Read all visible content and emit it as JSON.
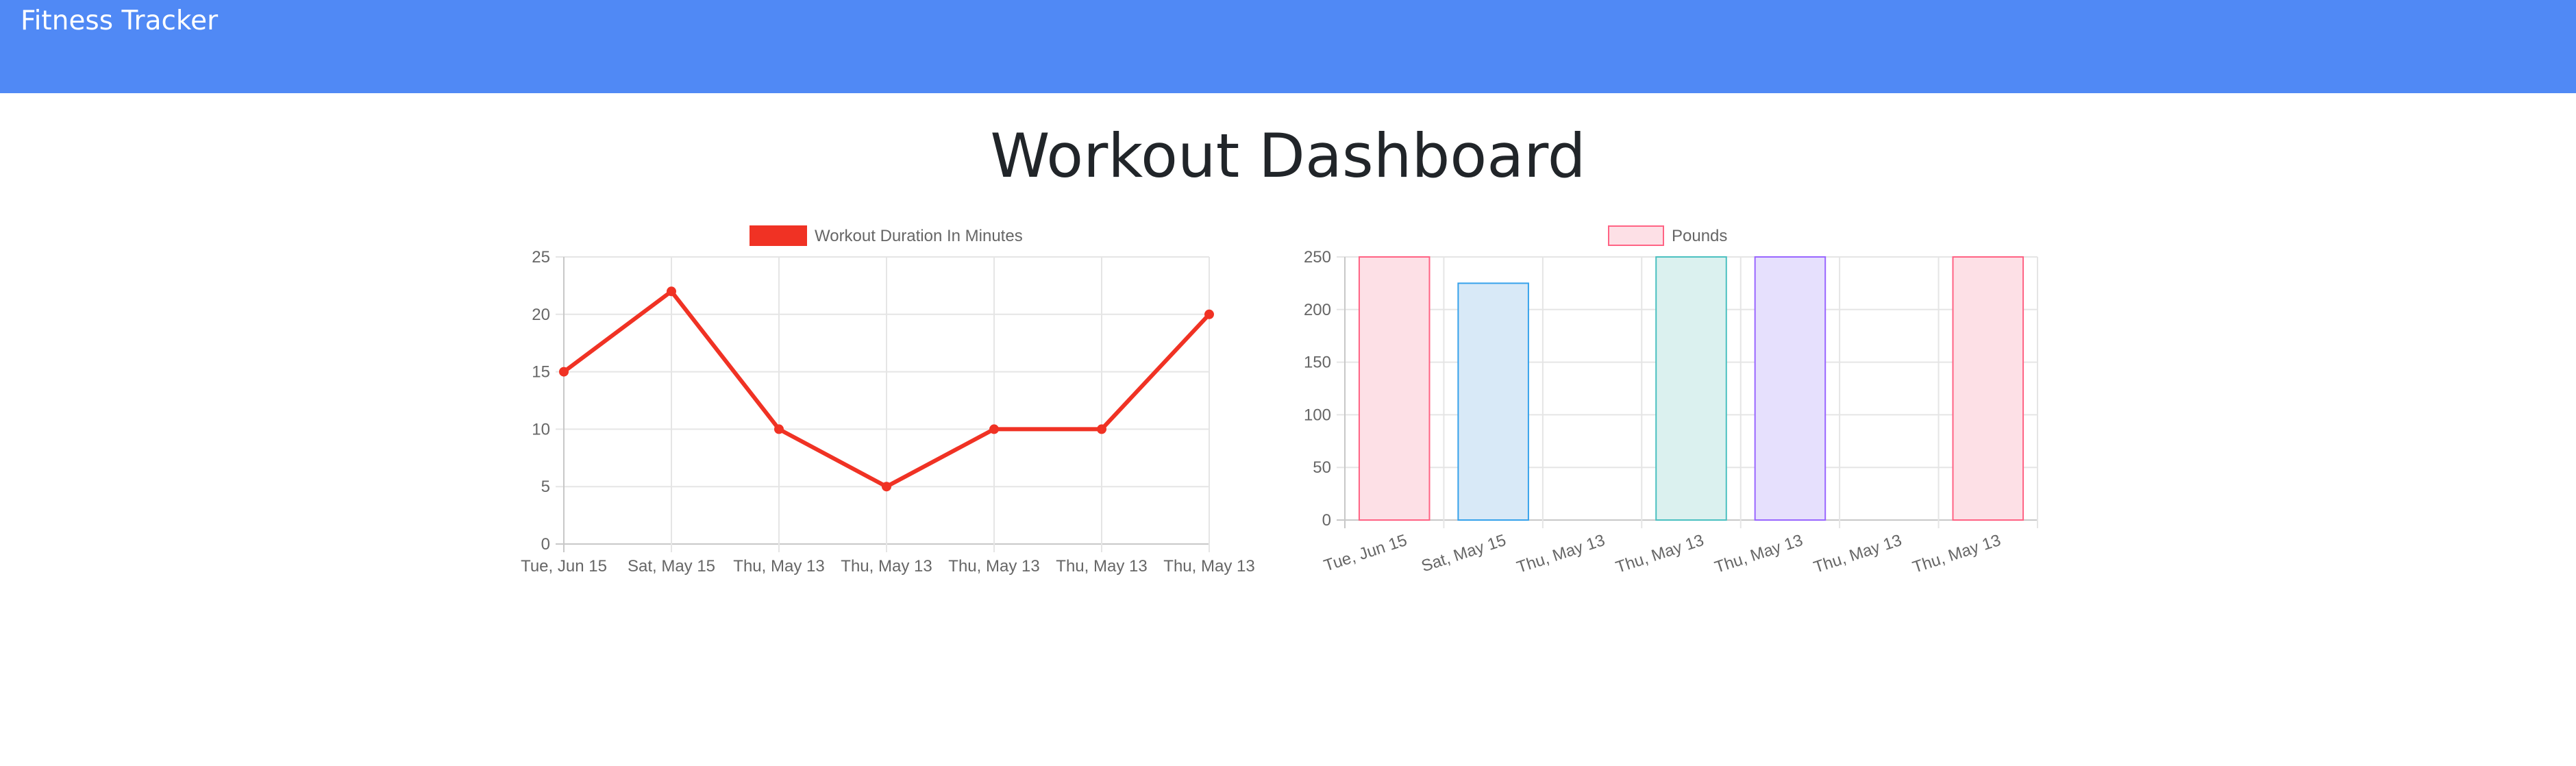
{
  "navbar": {
    "brand": "Fitness Tracker",
    "color": "#5089f5"
  },
  "page": {
    "title": "Workout Dashboard"
  },
  "chart_data": [
    {
      "type": "line",
      "legend": "Workout Duration In Minutes",
      "legend_position": "top",
      "categories": [
        "Tue, Jun 15",
        "Sat, May 15",
        "Thu, May 13",
        "Thu, May 13",
        "Thu, May 13",
        "Thu, May 13",
        "Thu, May 13"
      ],
      "series": [
        {
          "name": "Workout Duration In Minutes",
          "values": [
            15,
            22,
            10,
            5,
            10,
            10,
            20
          ],
          "color": "#f03224"
        }
      ],
      "ylim": [
        0,
        25
      ],
      "yticks": [
        0,
        5,
        10,
        15,
        20,
        25
      ],
      "grid": true
    },
    {
      "type": "bar",
      "legend": "Pounds",
      "legend_position": "top",
      "categories": [
        "Tue, Jun 15",
        "Sat, May 15",
        "Thu, May 13",
        "Thu, May 13",
        "Thu, May 13",
        "Thu, May 13",
        "Thu, May 13"
      ],
      "series": [
        {
          "name": "Pounds",
          "values": [
            250,
            225,
            0,
            250,
            250,
            0,
            250
          ]
        }
      ],
      "bar_fills": [
        "#fde0e6",
        "#d8e9f7",
        "#fff5e0",
        "#dbf1ef",
        "#e6e0fd",
        "#fff0e0",
        "#fde0e6"
      ],
      "bar_strokes": [
        "#ff6384",
        "#36a2eb",
        "#ffce56",
        "#4bc0c0",
        "#9966ff",
        "#ff9f40",
        "#ff6384"
      ],
      "ylim": [
        0,
        250
      ],
      "yticks": [
        0,
        50,
        100,
        150,
        200,
        250
      ],
      "grid": true
    }
  ]
}
